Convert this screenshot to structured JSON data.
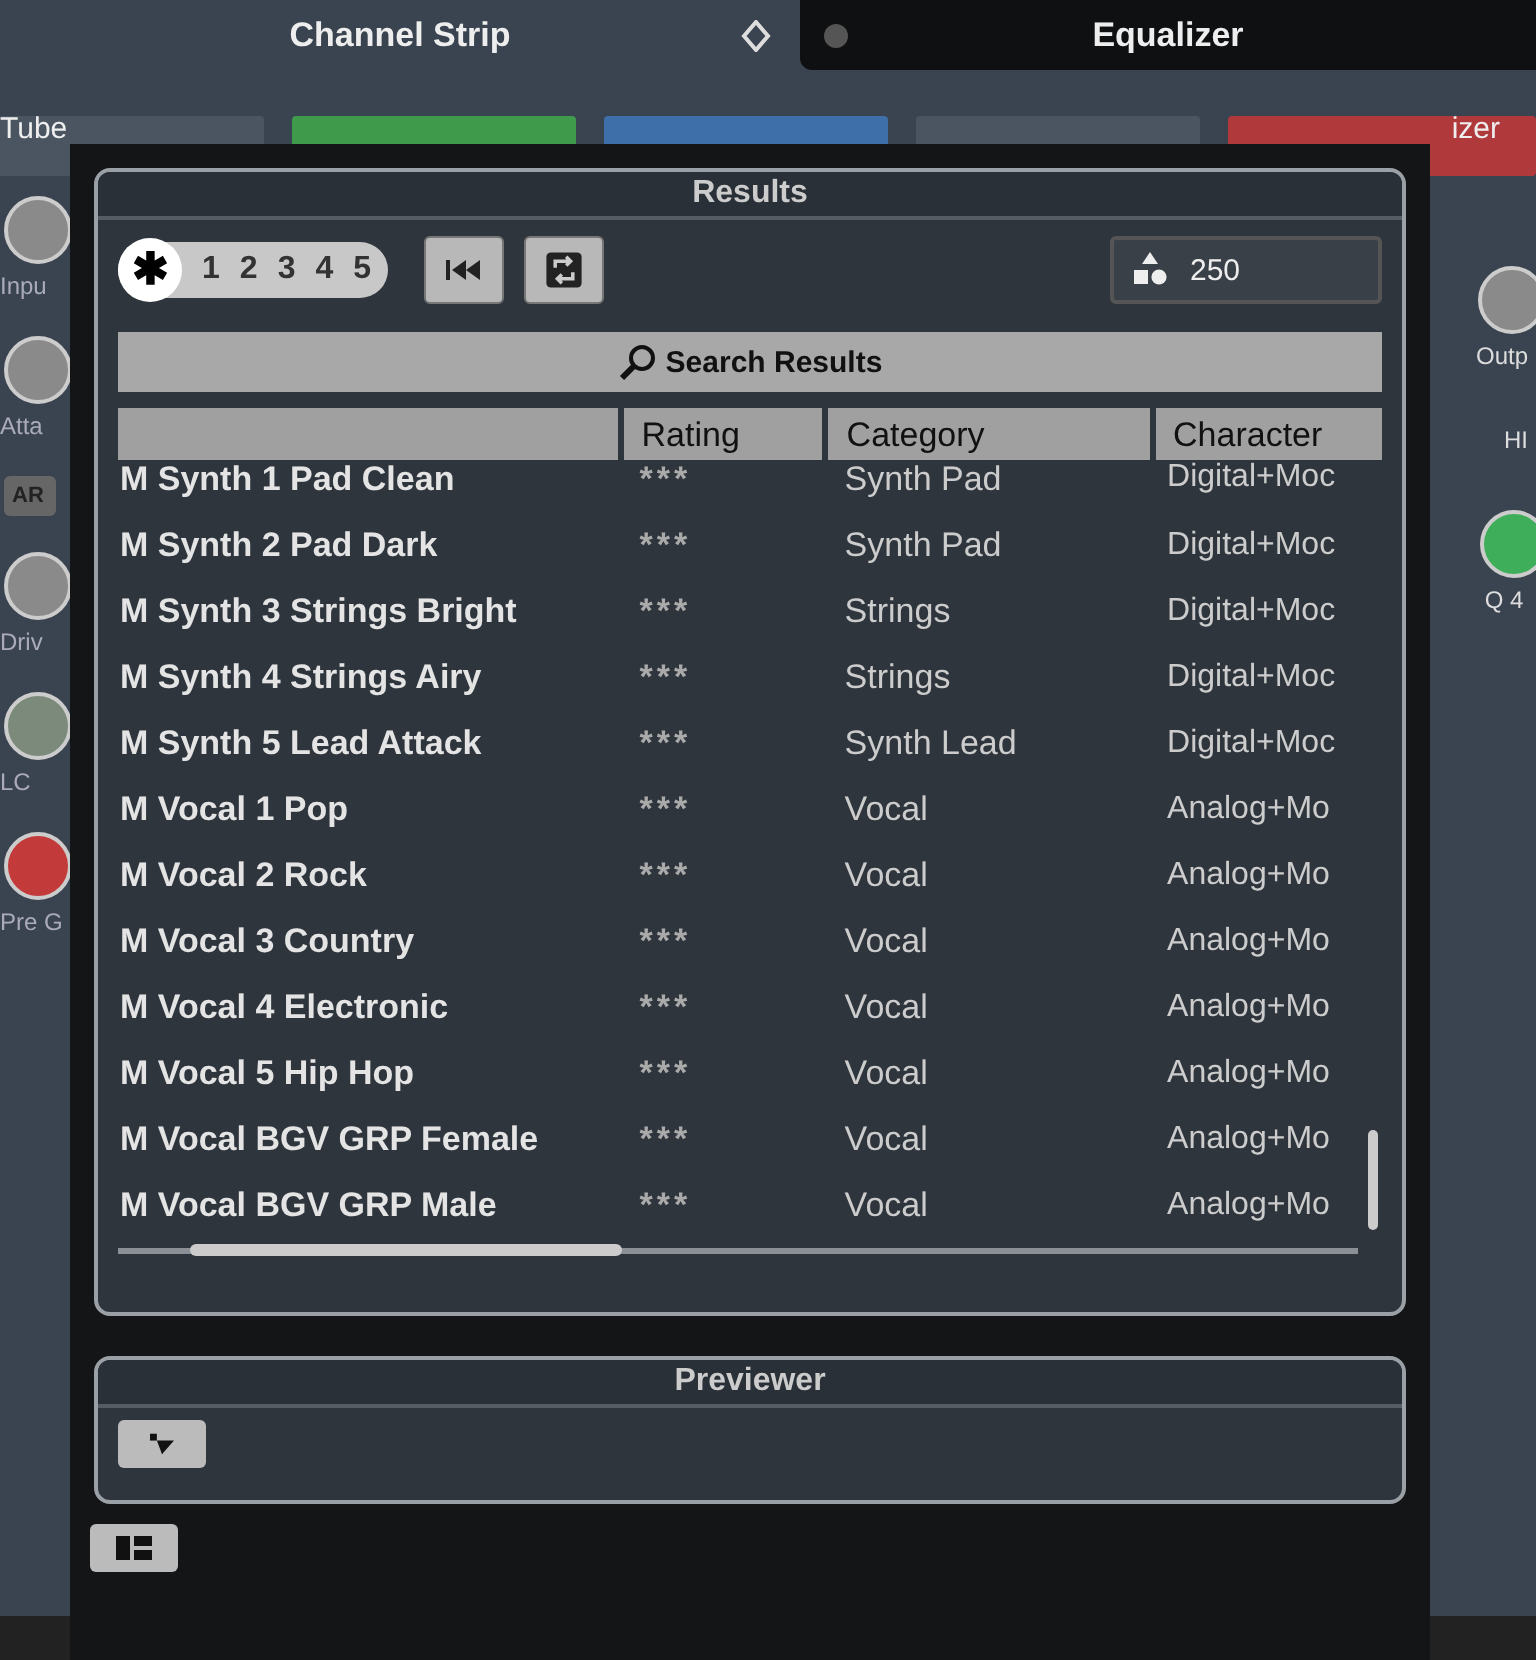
{
  "tabs": [
    {
      "label": "Channel Strip",
      "selected": true
    },
    {
      "label": "Equalizer",
      "selected": false
    }
  ],
  "modules": [
    {
      "label": "Tube",
      "color": "#4a5561"
    },
    {
      "color": "#3f9a4c"
    },
    {
      "color": "#3f6fa8"
    },
    {
      "color": "#4a5561"
    },
    {
      "label": "izer",
      "color": "#b0393c"
    }
  ],
  "left_knobs": [
    {
      "label": "Inpu",
      "color": "#8a8a8a"
    },
    {
      "label": "Atta",
      "color": "#8a8a8a"
    },
    {
      "button": "AR"
    },
    {
      "label": "Driv",
      "color": "#8a8a8a"
    },
    {
      "label": "LC",
      "color": "#7c8a7c"
    },
    {
      "label": "Pre G",
      "color": "#c23a3a"
    }
  ],
  "right_knobs": [
    {
      "label": "Outp",
      "color": "#8a8a8a"
    },
    {
      "label": "HI"
    },
    {
      "label": "Q 4",
      "color": "#3fae5a"
    }
  ],
  "results": {
    "title": "Results",
    "rating_filter": [
      {
        "label": "✱",
        "selected": true
      },
      {
        "label": "1",
        "selected": false
      },
      {
        "label": "2",
        "selected": false
      },
      {
        "label": "3",
        "selected": false
      },
      {
        "label": "4",
        "selected": false
      },
      {
        "label": "5",
        "selected": false
      }
    ],
    "count": "250",
    "search_button": "Search Results",
    "table": {
      "columns": [
        "",
        "Rating",
        "Category",
        "Character"
      ],
      "rows": [
        {
          "name": "M Synth 1 Pad Clean",
          "rating": "***",
          "category": "Synth Pad",
          "character": "Digital+Moc"
        },
        {
          "name": "M Synth 2 Pad Dark",
          "rating": "***",
          "category": "Synth Pad",
          "character": "Digital+Moc"
        },
        {
          "name": "M Synth 3 Strings Bright",
          "rating": "***",
          "category": "Strings",
          "character": "Digital+Moc"
        },
        {
          "name": "M Synth 4 Strings Airy",
          "rating": "***",
          "category": "Strings",
          "character": "Digital+Moc"
        },
        {
          "name": "M Synth 5 Lead Attack",
          "rating": "***",
          "category": "Synth Lead",
          "character": "Digital+Moc"
        },
        {
          "name": "M Vocal 1 Pop",
          "rating": "***",
          "category": "Vocal",
          "character": "Analog+Mo"
        },
        {
          "name": "M Vocal 2 Rock",
          "rating": "***",
          "category": "Vocal",
          "character": "Analog+Mo"
        },
        {
          "name": "M Vocal 3 Country",
          "rating": "***",
          "category": "Vocal",
          "character": "Analog+Mo"
        },
        {
          "name": "M Vocal 4 Electronic",
          "rating": "***",
          "category": "Vocal",
          "character": "Analog+Mo"
        },
        {
          "name": "M Vocal 5 Hip Hop",
          "rating": "***",
          "category": "Vocal",
          "character": "Analog+Mo"
        },
        {
          "name": "M Vocal BGV GRP Female",
          "rating": "***",
          "category": "Vocal",
          "character": "Analog+Mo"
        },
        {
          "name": "M Vocal BGV GRP Male",
          "rating": "***",
          "category": "Vocal",
          "character": "Analog+Mo"
        }
      ]
    }
  },
  "previewer": {
    "title": "Previewer"
  }
}
